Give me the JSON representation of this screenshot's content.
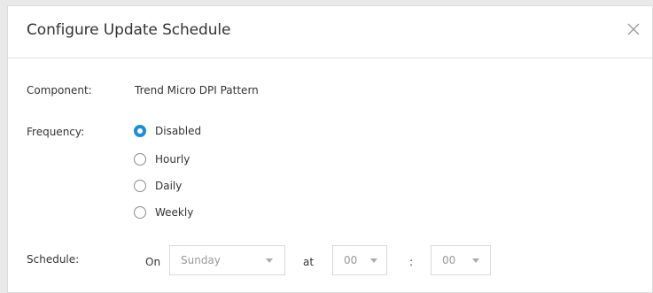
{
  "dialog": {
    "title": "Configure Update Schedule",
    "close_icon": "close-icon"
  },
  "component": {
    "label": "Component:",
    "value": "Trend Micro DPI Pattern"
  },
  "frequency": {
    "label": "Frequency:",
    "options": [
      "Disabled",
      "Hourly",
      "Daily",
      "Weekly"
    ],
    "selected": "Disabled"
  },
  "schedule": {
    "label": "Schedule:",
    "on_text": "On",
    "day": "Sunday",
    "at_text": "at",
    "hour": "00",
    "colon": ":",
    "minute": "00"
  },
  "colors": {
    "accent": "#1a8fd6"
  }
}
